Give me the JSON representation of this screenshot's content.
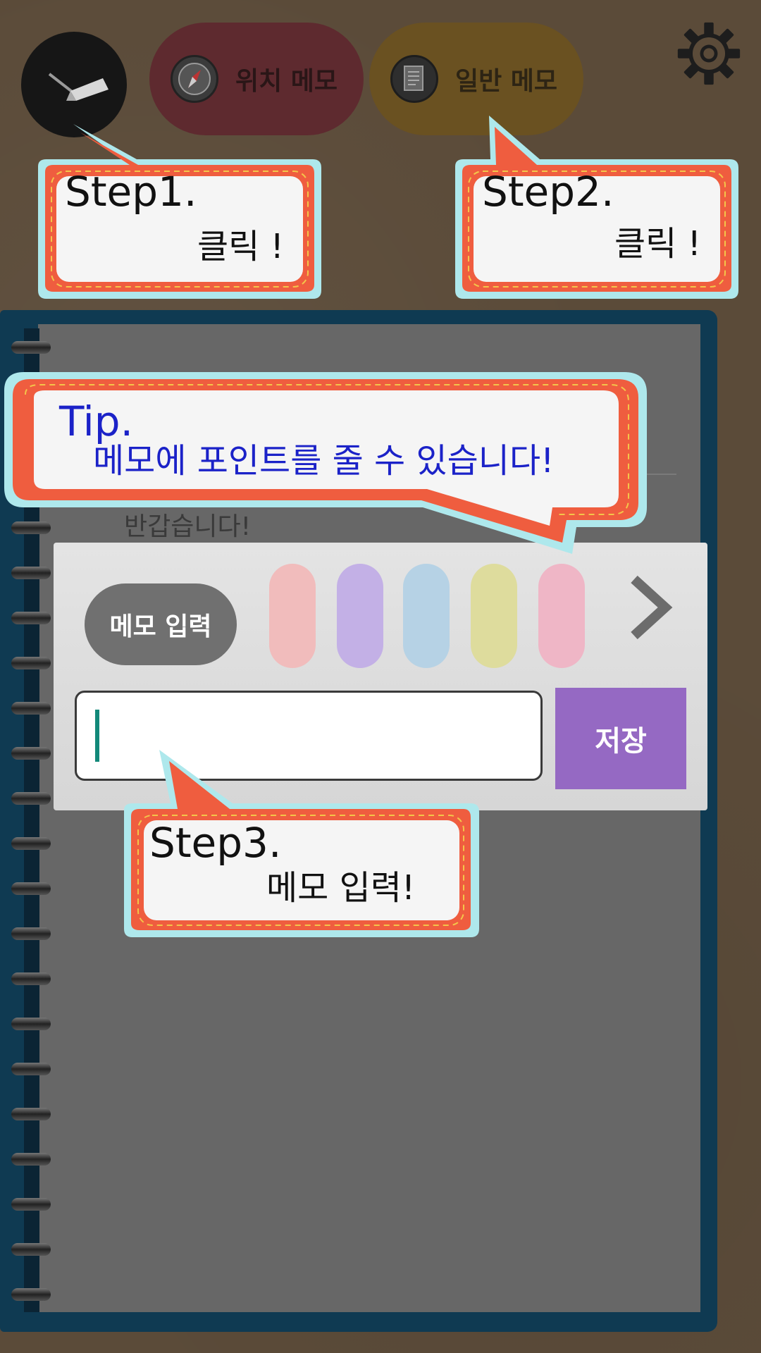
{
  "toolbar": {
    "location_memo_label": "위치 메모",
    "general_memo_label": "일반 메모"
  },
  "notebook": {
    "greeting": "반갑습니다!"
  },
  "memo_panel": {
    "label": "메모 입력",
    "input_value": "",
    "save_label": "저장",
    "colors": [
      "#f1bcbc",
      "#c3b0e6",
      "#b6d2e5",
      "#dedc9d",
      "#efb6c6"
    ]
  },
  "callouts": {
    "step1_title": "Step1.",
    "step1_body": "클릭 !",
    "step2_title": "Step2.",
    "step2_body": "클릭 !",
    "tip_title": "Tip.",
    "tip_body": "메모에 포인트를 줄 수 있습니다!",
    "step3_title": "Step3.",
    "step3_body": "메모 입력!"
  },
  "icons": {
    "pen": "pen-icon",
    "compass": "compass-icon",
    "document": "document-icon",
    "settings": "gear-icon",
    "next": "chevron-right-icon"
  }
}
